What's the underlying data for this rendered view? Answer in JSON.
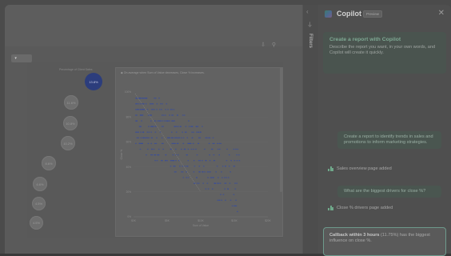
{
  "canvas": {
    "page_select_value": "",
    "tools": "⇩ ⚲"
  },
  "bubble_visual": {
    "title": "Percentage of Client Sales",
    "bubbles": [
      {
        "label": "13.8%",
        "primary": true
      },
      {
        "label": "11.6%",
        "primary": false
      },
      {
        "label": "10.8%",
        "primary": false
      },
      {
        "label": "10.2%",
        "primary": false
      },
      {
        "label": "8.6%",
        "primary": false
      },
      {
        "label": "6.6%",
        "primary": false
      },
      {
        "label": "4.5%",
        "primary": false
      },
      {
        "label": "4.5%",
        "primary": false
      }
    ]
  },
  "scatter_visual": {
    "title": "On average when Sum of Value decreases, Close % increases.",
    "xlabel": "Sum of Value",
    "ylabel": "Close %",
    "x_ticks": [
      "$0K",
      "$5K",
      "$10K",
      "$15K",
      "$20K"
    ],
    "y_ticks": [
      "100%",
      "80%",
      "60%",
      "40%",
      "20%",
      "0%"
    ]
  },
  "filters": {
    "label": "Filters"
  },
  "copilot": {
    "title": "Copilot",
    "badge": "Preview",
    "intro_title": "Create a report with Copilot",
    "intro_body": "Describe the report you want, in your own words, and Copilot will create it quickly.",
    "messages": [
      {
        "type": "user",
        "text": "Create a report to identify trends in sales and promotions to inform marketing strategies."
      },
      {
        "type": "status",
        "text": "Sales overview page added"
      },
      {
        "type": "user",
        "text": "What are the biggest drivers for close %?"
      },
      {
        "type": "status",
        "text": "Close % drivers page added"
      }
    ],
    "answer_bold": "Callback within 3 hours",
    "answer_pct": "(11.75%)",
    "answer_rest": "has the biggest influence on close %."
  },
  "colors": {
    "primary_bubble": "#2c3d7c",
    "accent_green": "#6d9a8c",
    "scatter_points": "#3b4f9a"
  }
}
